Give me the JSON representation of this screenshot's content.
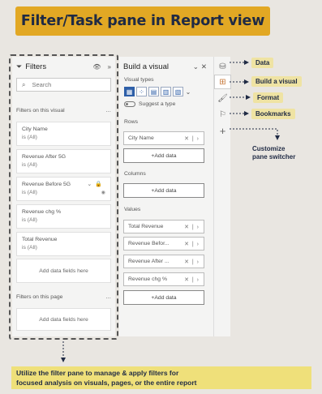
{
  "banner": {
    "title": "Filter/Task pane in Report view"
  },
  "filters": {
    "title": "Filters",
    "search_placeholder": "Search",
    "on_visual_label": "Filters on this visual",
    "cards": [
      {
        "name": "City Name",
        "state": "is (All)"
      },
      {
        "name": "Revenue After 5G",
        "state": "is (All)"
      },
      {
        "name": "Revenue Before 5G",
        "state": "is (All)"
      },
      {
        "name": "Revenue chg %",
        "state": "is (All)"
      },
      {
        "name": "Total Revenue",
        "state": "is (All)"
      }
    ],
    "add_fields_visual": "Add data fields here",
    "on_page_label": "Filters on this page",
    "add_fields_page": "Add data fields here"
  },
  "visual": {
    "title": "Build a visual",
    "types_label": "Visual types",
    "suggest_label": "Suggest a type",
    "toggle_label": "Off",
    "rows_label": "Rows",
    "rows_fields": [
      "City Name"
    ],
    "add_data": "+Add data",
    "columns_label": "Columns",
    "values_label": "Values",
    "values_fields": [
      "Total Revenue",
      "Revenue Befor...",
      "Revenue After ...",
      "Revenue chg %"
    ]
  },
  "callouts": {
    "data": "Data",
    "build": "Build a visual",
    "format": "Format",
    "bookmarks": "Bookmarks",
    "customize_1": "Customize",
    "customize_2": "pane switcher"
  },
  "note": {
    "line1": "Utilize the filter pane to manage & apply filters for",
    "line2": "focused analysis on visuals, pages, or the entire report"
  },
  "colors": {
    "banner": "#e2a824",
    "callout": "#efe3a3",
    "note": "#efe07a",
    "accent": "#2e5fa8"
  }
}
